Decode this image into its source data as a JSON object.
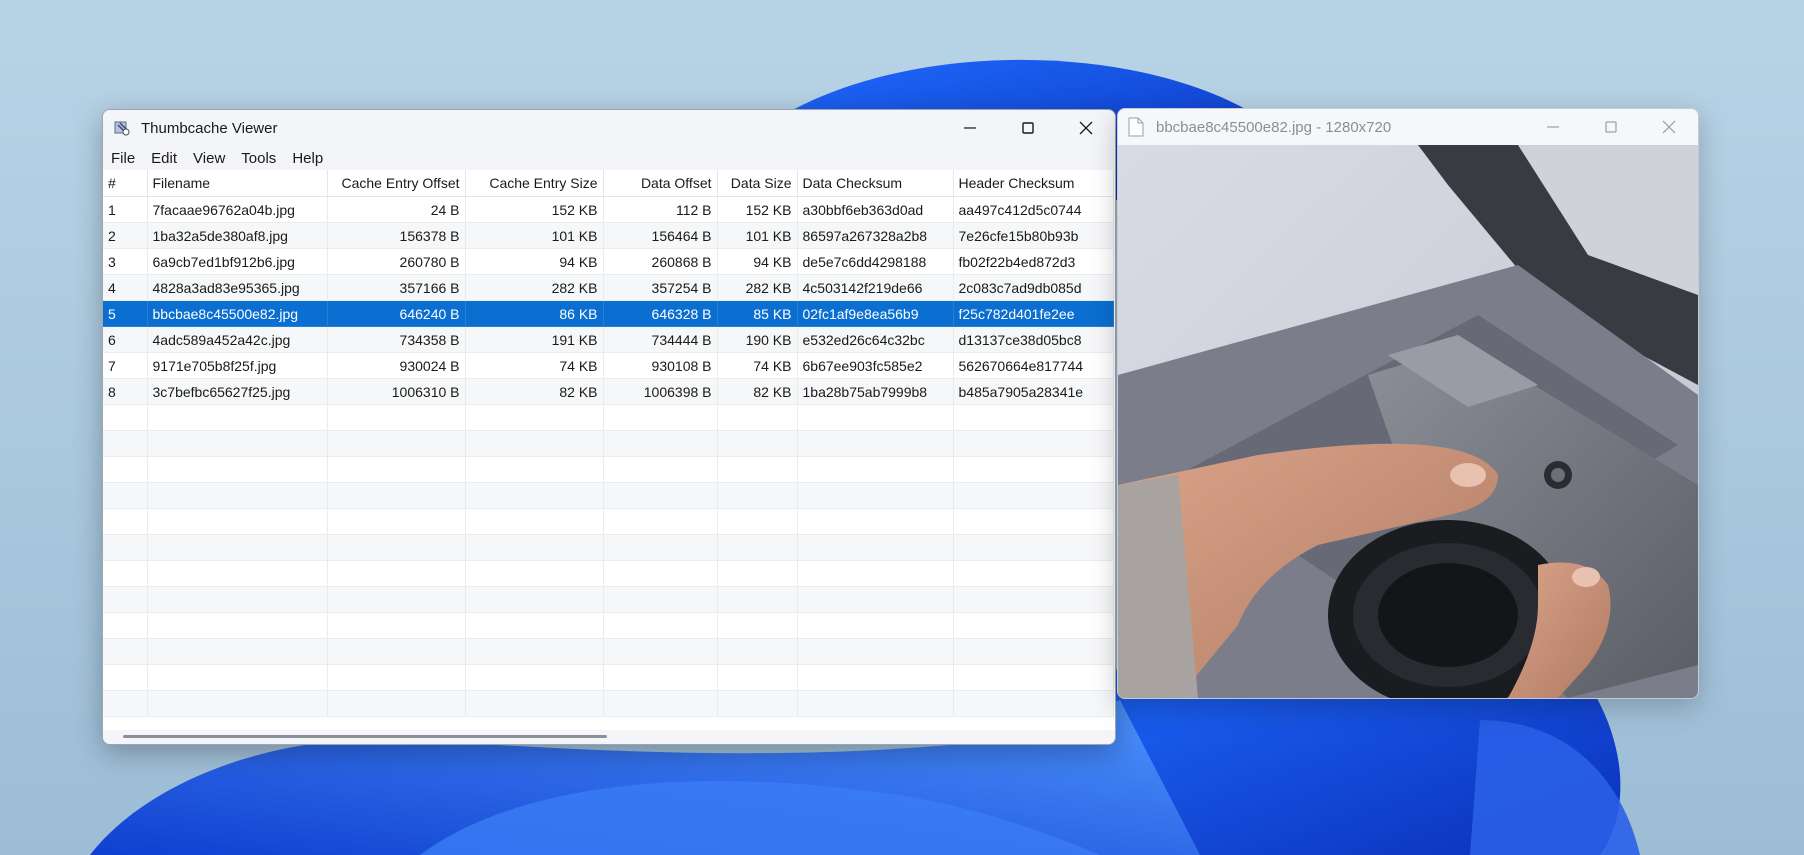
{
  "main_window": {
    "title": "Thumbcache Viewer",
    "menu": [
      "File",
      "Edit",
      "View",
      "Tools",
      "Help"
    ],
    "columns": [
      "#",
      "Filename",
      "Cache Entry Offset",
      "Cache Entry Size",
      "Data Offset",
      "Data Size",
      "Data Checksum",
      "Header Checksum"
    ],
    "rows": [
      [
        "1",
        "7facaae96762a04b.jpg",
        "24 B",
        "152 KB",
        "112 B",
        "152 KB",
        "a30bbf6eb363d0ad",
        "aa497c412d5c0744"
      ],
      [
        "2",
        "1ba32a5de380af8.jpg",
        "156378 B",
        "101 KB",
        "156464 B",
        "101 KB",
        "86597a267328a2b8",
        "7e26cfe15b80b93b"
      ],
      [
        "3",
        "6a9cb7ed1bf912b6.jpg",
        "260780 B",
        "94 KB",
        "260868 B",
        "94 KB",
        "de5e7c6dd4298188",
        "fb02f22b4ed872d3"
      ],
      [
        "4",
        "4828a3ad83e95365.jpg",
        "357166 B",
        "282 KB",
        "357254 B",
        "282 KB",
        "4c503142f219de66",
        "2c083c7ad9db085d"
      ],
      [
        "5",
        "bbcbae8c45500e82.jpg",
        "646240 B",
        "86 KB",
        "646328 B",
        "85 KB",
        "02fc1af9e8ea56b9",
        "f25c782d401fe2ee"
      ],
      [
        "6",
        "4adc589a452a42c.jpg",
        "734358 B",
        "191 KB",
        "734444 B",
        "190 KB",
        "e532ed26c64c32bc",
        "d13137ce38d05bc8"
      ],
      [
        "7",
        "9171e705b8f25f.jpg",
        "930024 B",
        "74 KB",
        "930108 B",
        "74 KB",
        "6b67ee903fc585e2",
        "562670664e817744"
      ],
      [
        "8",
        "3c7befbc65627f25.jpg",
        "1006310 B",
        "82 KB",
        "1006398 B",
        "82 KB",
        "1ba28b75ab7999b8",
        "b485a7905a28341e"
      ]
    ],
    "selected_row": 5,
    "empty_rows": 12,
    "selection_color": "#0a6fd1"
  },
  "image_window": {
    "title": "bbcbae8c45500e82.jpg - 1280x720"
  }
}
